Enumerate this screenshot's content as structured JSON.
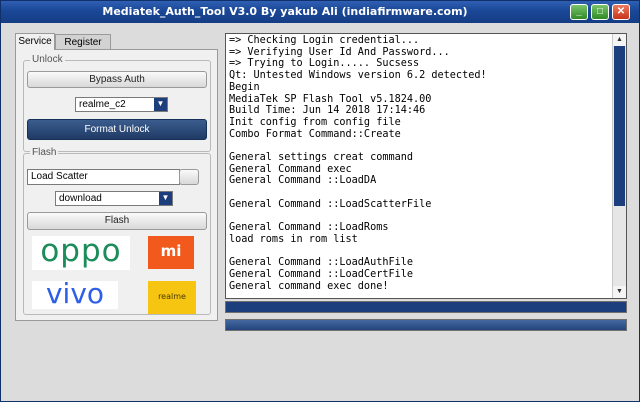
{
  "window": {
    "title": "Mediatek_Auth_Tool V3.0 By yakub Ali (indiafirmware.com)"
  },
  "window_controls": {
    "minimize": "_",
    "maximize": "□",
    "close": "✕"
  },
  "tabs": [
    {
      "label": "Service",
      "active": true
    },
    {
      "label": "Register",
      "active": false
    }
  ],
  "unlock": {
    "group_label": "Unlock",
    "bypass_label": "Bypass Auth",
    "model_select": "realme_c2",
    "format_label": "Format Unlock"
  },
  "flash": {
    "group_label": "Flash",
    "scatter_input": "Load Scatter",
    "mode_select": "download",
    "flash_label": "Flash"
  },
  "brands": {
    "oppo": "oppo",
    "mi": "mi",
    "vivo": "vivo",
    "realme": "realme"
  },
  "console_lines": [
    "=> Checking Login credential...",
    "=> Verifying User Id And Password...",
    "=> Trying to Login..... Sucsess",
    "Qt: Untested Windows version 6.2 detected!",
    "Begin",
    "MediaTek SP Flash Tool v5.1824.00",
    "Build Time: Jun 14 2018 17:14:46",
    "Init config from config file",
    "Combo Format Command::Create",
    "",
    "General settings creat command",
    "General Command exec",
    "General Command ::LoadDA",
    "",
    "General Command ::LoadScatterFile",
    "",
    "General Command ::LoadRoms",
    "load roms in rom list",
    "",
    "General Command ::LoadAuthFile",
    "General Command ::LoadCertFile",
    "General command exec done!"
  ],
  "colors": {
    "accent": "#1d3e7c",
    "title_bar": "#1a4796",
    "mi_orange": "#f25a1d",
    "realme_yellow": "#f6c511",
    "oppo_green": "#1c8c5a",
    "vivo_blue": "#2c5ee8"
  }
}
